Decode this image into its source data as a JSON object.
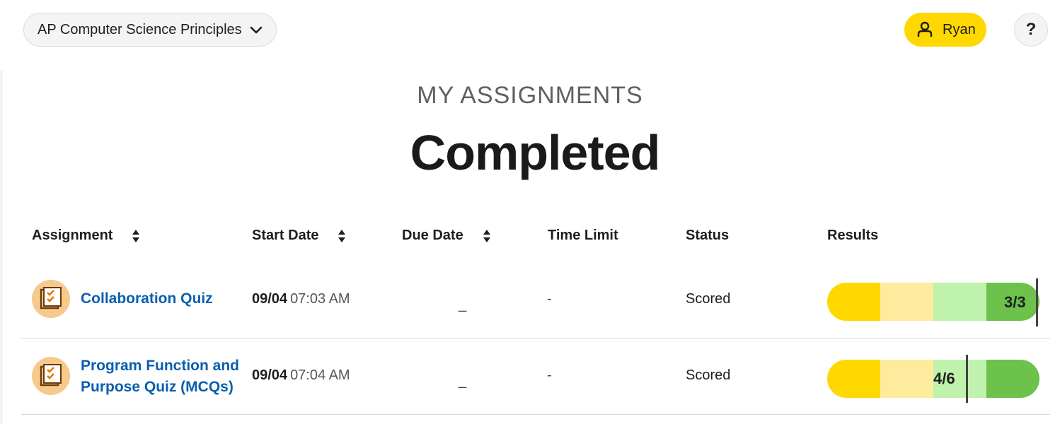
{
  "header": {
    "course_label": "AP Computer Science Principles",
    "user_name": "Ryan",
    "help_label": "?"
  },
  "page": {
    "kicker": "MY ASSIGNMENTS",
    "title": "Completed"
  },
  "table": {
    "columns": {
      "assignment": "Assignment",
      "start_date": "Start Date",
      "due_date": "Due Date",
      "time_limit": "Time Limit",
      "status": "Status",
      "results": "Results"
    },
    "rows": [
      {
        "name": "Collaboration Quiz",
        "start_date": "09/04",
        "start_time": "07:03 AM",
        "due": "_",
        "time_limit": "-",
        "status": "Scored",
        "score_text": "3/3",
        "score_fraction": 1.0
      },
      {
        "name_line1": "Program Function and",
        "name_line2": "Purpose Quiz (MCQs)",
        "start_date": "09/04",
        "start_time": "07:04 AM",
        "due": "_",
        "time_limit": "-",
        "status": "Scored",
        "score_text": "4/6",
        "score_fraction": 0.6667
      }
    ]
  },
  "colors": {
    "accent_yellow": "#ffd800",
    "link_blue": "#0a5eb0",
    "result_segments": [
      "#ffd800",
      "#ffeb9e",
      "#bff2ac",
      "#6cc24a"
    ]
  },
  "icons": {
    "course_dropdown": "chevron-down-icon",
    "user": "user-icon",
    "sort": "sort-icon",
    "assignment": "quiz-checklist-icon"
  }
}
